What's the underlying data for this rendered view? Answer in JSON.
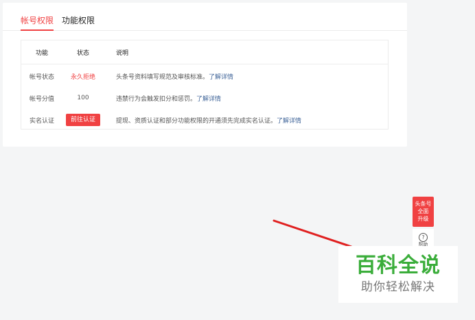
{
  "tabs": [
    {
      "label": "帐号权限",
      "active": true
    },
    {
      "label": "功能权限",
      "active": false
    }
  ],
  "table": {
    "headers": [
      "功能",
      "状态",
      "说明"
    ],
    "rows": [
      {
        "feature": "帐号状态",
        "status": "永久拒绝",
        "desc": "头条号资料填写规范及审核标准。",
        "link": "了解详情"
      },
      {
        "feature": "帐号分值",
        "status": "100",
        "desc": "违禁行为会触发扣分和惩罚。",
        "link": "了解详情"
      },
      {
        "feature": "实名认证",
        "status": "前往认证",
        "desc": "提现、资质认证和部分功能权限的开通须先完成实名认证。",
        "link": "了解详情"
      }
    ]
  },
  "float_badge": {
    "lines": [
      "头条号",
      "全面",
      "升级"
    ]
  },
  "help": {
    "icon": "?",
    "label": "帮助"
  },
  "watermark": {
    "title": "百科全说",
    "subtitle": "助你轻松解决"
  },
  "colors": {
    "accent": "#f04142",
    "link": "#406599",
    "watermark_green": "#3aad3a"
  }
}
